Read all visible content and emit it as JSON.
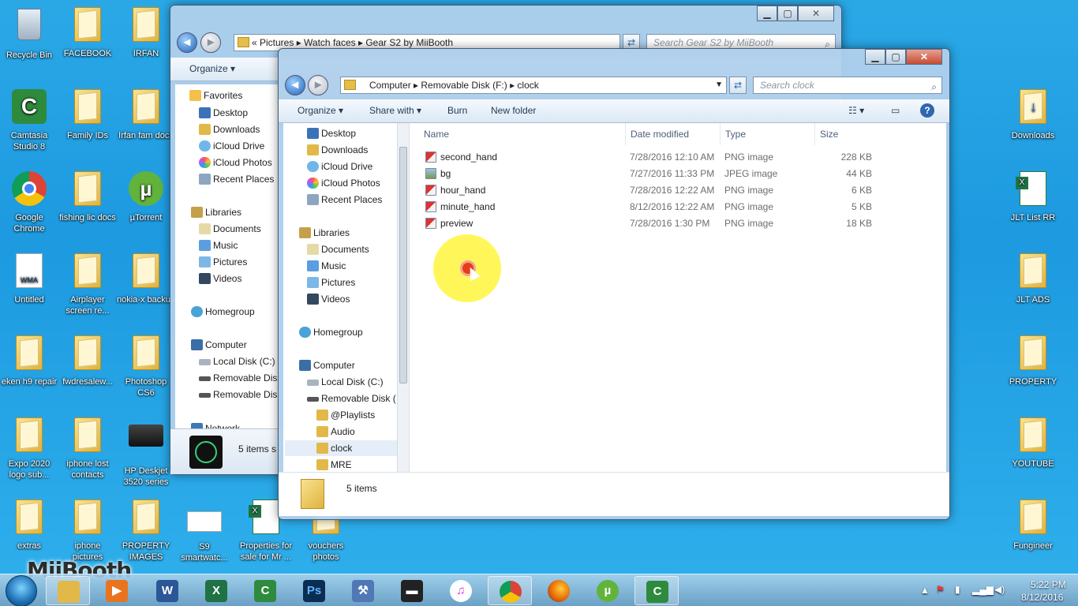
{
  "desktop": {
    "left_icons": [
      {
        "label": "Recycle Bin",
        "kind": "recycle"
      },
      {
        "label": "FACEBOOK",
        "kind": "folder"
      },
      {
        "label": "IRFAN",
        "kind": "folder"
      },
      {
        "label": "Camtasia Studio 8",
        "kind": "camtasia"
      },
      {
        "label": "Family IDs",
        "kind": "folder"
      },
      {
        "label": "Irfan fam docs",
        "kind": "folder"
      },
      {
        "label": "Google Chrome",
        "kind": "chrome"
      },
      {
        "label": "fishing lic docs",
        "kind": "folder"
      },
      {
        "label": "µTorrent",
        "kind": "utorrent"
      },
      {
        "label": "Untitled",
        "kind": "wma"
      },
      {
        "label": "Airplayer screen re...",
        "kind": "folder"
      },
      {
        "label": "nokia-x backup",
        "kind": "folder"
      },
      {
        "label": "eken h9 repair",
        "kind": "folder"
      },
      {
        "label": "fwdresalew...",
        "kind": "folder"
      },
      {
        "label": "Photoshop CS6",
        "kind": "folder"
      },
      {
        "label": "Expo 2020 logo sub...",
        "kind": "folder"
      },
      {
        "label": "iphone lost contacts",
        "kind": "folder"
      },
      {
        "label": "HP Deskjet 3520 series",
        "kind": "printer"
      },
      {
        "label": "extras",
        "kind": "folder"
      },
      {
        "label": "iphone pictures",
        "kind": "folder"
      },
      {
        "label": "PROPERTY IMAGES",
        "kind": "folder"
      },
      {
        "label": "S9 smartwatc...",
        "kind": "doc"
      },
      {
        "label": "Properties for sale for Mr ...",
        "kind": "excel"
      },
      {
        "label": "vouchers photos",
        "kind": "folder"
      }
    ],
    "right_icons": [
      {
        "label": "Downloads",
        "kind": "folder"
      },
      {
        "label": "JLT List RR",
        "kind": "excel"
      },
      {
        "label": "JLT ADS",
        "kind": "folder"
      },
      {
        "label": "PROPERTY",
        "kind": "folder"
      },
      {
        "label": "YOUTUBE",
        "kind": "folder"
      },
      {
        "label": "Fungineer",
        "kind": "folder"
      }
    ]
  },
  "back_window": {
    "address_parts": [
      "«",
      "Pictures",
      "▸",
      "Watch faces",
      "▸",
      "Gear S2 by MiiBooth"
    ],
    "address_text": "« Pictures ▸ Watch faces ▸ Gear S2 by MiiBooth",
    "search_placeholder": "Search Gear S2 by MiiBooth",
    "organize_label": "Organize ▾",
    "favorites_label": "Favorites",
    "favorites": [
      "Desktop",
      "Downloads",
      "iCloud Drive",
      "iCloud Photos",
      "Recent Places"
    ],
    "libraries_label": "Libraries",
    "libraries": [
      "Documents",
      "Music",
      "Pictures",
      "Videos"
    ],
    "homegroup_label": "Homegroup",
    "computer_label": "Computer",
    "drives": [
      "Local Disk (C:)",
      "Removable Disk",
      "Removable Disk"
    ],
    "network_label": "Network",
    "status_text": "5 items s"
  },
  "front_window": {
    "address_text": "Computer ▸ Removable Disk (F:) ▸ clock",
    "search_placeholder": "Search clock",
    "toolbar": {
      "organize": "Organize ▾",
      "share": "Share with ▾",
      "burn": "Burn",
      "new_folder": "New folder"
    },
    "nav": {
      "favorites": [
        "Desktop",
        "Downloads",
        "iCloud Drive",
        "iCloud Photos",
        "Recent Places"
      ],
      "libraries_label": "Libraries",
      "libraries": [
        "Documents",
        "Music",
        "Pictures",
        "Videos"
      ],
      "homegroup_label": "Homegroup",
      "computer_label": "Computer",
      "drives": [
        "Local Disk (C:)",
        "Removable Disk ("
      ],
      "subfolders": [
        "@Playlists",
        "Audio",
        "clock",
        "MRE"
      ]
    },
    "columns": {
      "name": "Name",
      "date": "Date modified",
      "type": "Type",
      "size": "Size"
    },
    "files": [
      {
        "name": "second_hand",
        "date": "7/28/2016 12:10 AM",
        "type": "PNG image",
        "size": "228 KB"
      },
      {
        "name": "bg",
        "date": "7/27/2016 11:33 PM",
        "type": "JPEG image",
        "size": "44 KB"
      },
      {
        "name": "hour_hand",
        "date": "7/28/2016 12:22 AM",
        "type": "PNG image",
        "size": "6 KB"
      },
      {
        "name": "minute_hand",
        "date": "8/12/2016 12:22 AM",
        "type": "PNG image",
        "size": "5 KB"
      },
      {
        "name": "preview",
        "date": "7/28/2016 1:30 PM",
        "type": "PNG image",
        "size": "18 KB"
      }
    ],
    "status_text": "5 items"
  },
  "taskbar": {
    "apps": [
      "explorer",
      "media",
      "word",
      "excel",
      "camtasia",
      "photoshop",
      "tools",
      "printer",
      "itunes",
      "chrome",
      "firefox",
      "utorrent",
      "camtasia-recorder"
    ],
    "clock_time": "5:22 PM",
    "clock_date": "8/12/2016"
  },
  "watermark": "MiiBooth",
  "colors": {
    "accent": "#3a78c2",
    "desktop": "#1d9ae0",
    "highlight": "#fff63c"
  }
}
